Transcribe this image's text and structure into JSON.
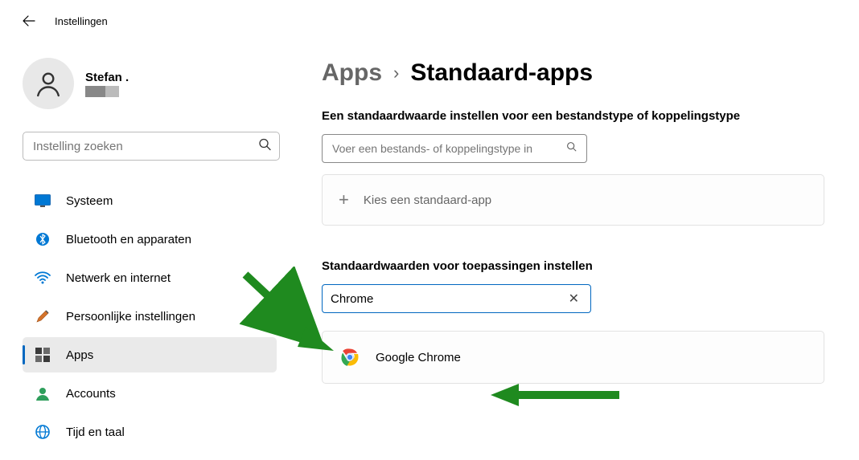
{
  "window": {
    "title": "Instellingen"
  },
  "profile": {
    "name": "Stefan ."
  },
  "sidebar": {
    "search_placeholder": "Instelling zoeken",
    "items": [
      {
        "label": "Systeem"
      },
      {
        "label": "Bluetooth en apparaten"
      },
      {
        "label": "Netwerk en internet"
      },
      {
        "label": "Persoonlijke instellingen"
      },
      {
        "label": "Apps",
        "selected": true
      },
      {
        "label": "Accounts"
      },
      {
        "label": "Tijd en taal"
      }
    ]
  },
  "breadcrumb": {
    "parent": "Apps",
    "current": "Standaard-apps"
  },
  "main": {
    "section1_heading": "Een standaardwaarde instellen voor een bestandstype of koppelingstype",
    "filetype_placeholder": "Voer een bestands- of koppelingstype in",
    "choose_default_label": "Kies een standaard-app",
    "section2_heading": "Standaardwaarden voor toepassingen instellen",
    "app_search_value": "Chrome",
    "result": {
      "label": "Google Chrome"
    },
    "clear_glyph": "✕"
  }
}
